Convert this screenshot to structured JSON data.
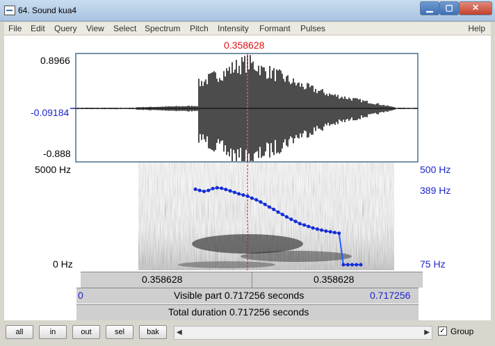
{
  "window": {
    "title": "64. Sound kua4",
    "min_label": "▁",
    "max_label": "▢",
    "close_label": "✕"
  },
  "menu": {
    "items": [
      "File",
      "Edit",
      "Query",
      "View",
      "Select",
      "Spectrum",
      "Pitch",
      "Intensity",
      "Formant",
      "Pulses"
    ],
    "help": "Help"
  },
  "cursor": {
    "time_label": "0.358628",
    "time_s": 0.358628
  },
  "waveform": {
    "ymax": "0.8966",
    "ymid": "-0.09184",
    "ymin": "-0.888"
  },
  "spectrogram": {
    "freq_top": "5000 Hz",
    "freq_bottom": "0 Hz"
  },
  "pitch": {
    "top": "500 Hz",
    "cursor_value": "389 Hz",
    "bottom": "75 Hz",
    "contour_hz": [
      389,
      384,
      380,
      384,
      392,
      395,
      393,
      388,
      382,
      376,
      370,
      365,
      360,
      352,
      345,
      336,
      326,
      315,
      305,
      294,
      284,
      274,
      264,
      255,
      246,
      240,
      234,
      228,
      223,
      219,
      215,
      212,
      209,
      206,
      75,
      75,
      75,
      75,
      75
    ]
  },
  "selection": {
    "left_label": "0.358628",
    "right_label": "0.358628"
  },
  "visible": {
    "start": "0",
    "text": "Visible part 0.717256 seconds",
    "end": "0.717256"
  },
  "total": {
    "text": "Total duration 0.717256 seconds"
  },
  "buttons": {
    "all": "all",
    "in": "in",
    "out": "out",
    "sel": "sel",
    "bak": "bak"
  },
  "group": {
    "label": "Group",
    "checked": true
  }
}
